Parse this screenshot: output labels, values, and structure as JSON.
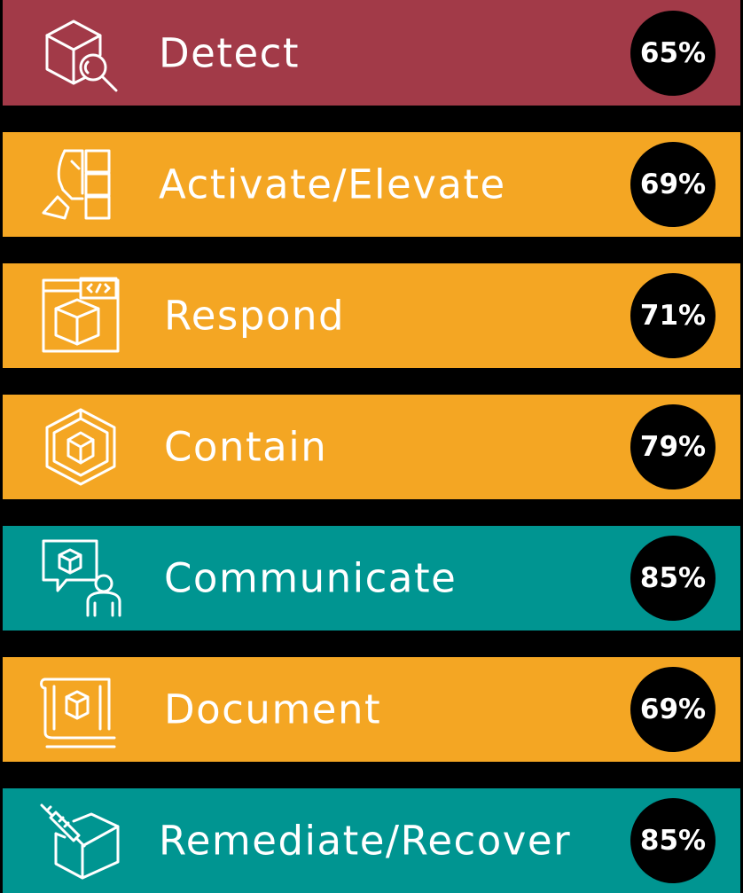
{
  "items": [
    {
      "label": "Detect",
      "percent": "65%",
      "color": "#A23A48",
      "icon": "box-magnifier-icon"
    },
    {
      "label": "Activate/Elevate",
      "percent": "69%",
      "color": "#F4A623",
      "icon": "hand-boxes-icon"
    },
    {
      "label": "Respond",
      "percent": "71%",
      "color": "#F4A623",
      "icon": "code-window-box-icon"
    },
    {
      "label": "Contain",
      "percent": "79%",
      "color": "#F4A623",
      "icon": "contained-box-icon"
    },
    {
      "label": "Communicate",
      "percent": "85%",
      "color": "#009591",
      "icon": "chat-person-icon"
    },
    {
      "label": "Document",
      "percent": "69%",
      "color": "#F4A623",
      "icon": "document-box-icon"
    },
    {
      "label": "Remediate/Recover",
      "percent": "85%",
      "color": "#009591",
      "icon": "syringe-box-icon"
    }
  ]
}
